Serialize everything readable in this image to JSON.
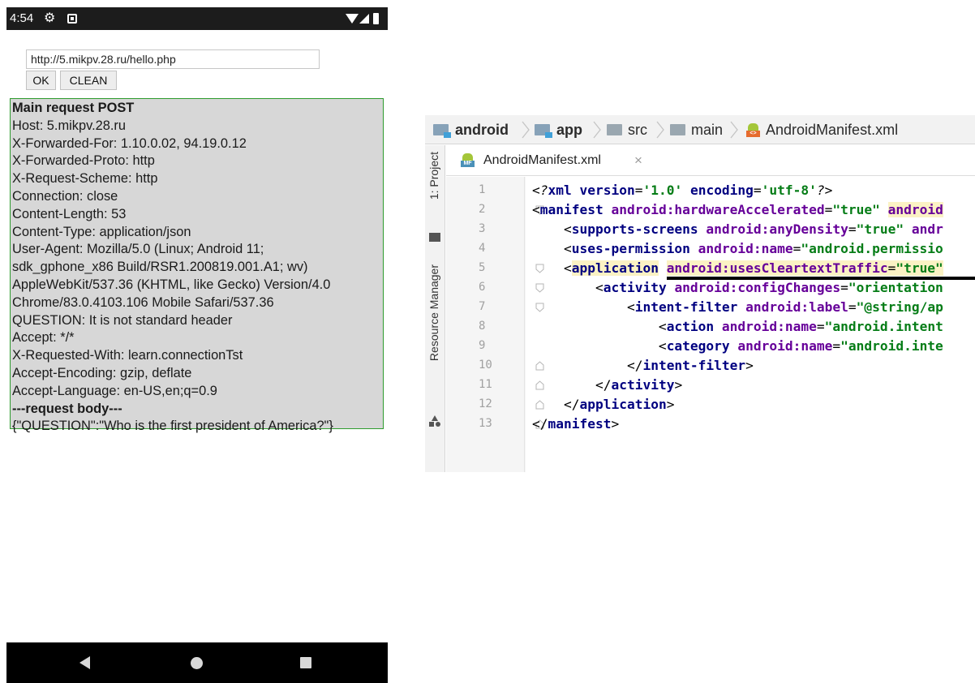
{
  "phone": {
    "status": {
      "time": "4:54",
      "icons": [
        "gear-icon",
        "sim-icon",
        "wifi-icon",
        "signal-icon",
        "battery-icon"
      ]
    },
    "url_value": "http://5.mikpv.28.ru/hello.php",
    "buttons": {
      "ok": "OK",
      "clean": "CLEAN"
    },
    "response_lines": [
      {
        "text": "Main request POST",
        "bold": true
      },
      {
        "text": "Host: 5.mikpv.28.ru",
        "bold": false
      },
      {
        "text": "X-Forwarded-For: 1.10.0.02, 94.19.0.12",
        "bold": false
      },
      {
        "text": "X-Forwarded-Proto: http",
        "bold": false
      },
      {
        "text": "X-Request-Scheme: http",
        "bold": false
      },
      {
        "text": "Connection: close",
        "bold": false
      },
      {
        "text": "Content-Length: 53",
        "bold": false
      },
      {
        "text": "Content-Type: application/json",
        "bold": false
      },
      {
        "text": "User-Agent: Mozilla/5.0 (Linux; Android 11;",
        "bold": false
      },
      {
        "text": "sdk_gphone_x86 Build/RSR1.200819.001.A1; wv)",
        "bold": false
      },
      {
        "text": "AppleWebKit/537.36 (KHTML, like Gecko) Version/4.0",
        "bold": false
      },
      {
        "text": "Chrome/83.0.4103.106 Mobile Safari/537.36",
        "bold": false
      },
      {
        "text": "QUESTION: It is not standard header",
        "bold": false
      },
      {
        "text": "Accept: */*",
        "bold": false
      },
      {
        "text": "X-Requested-With: learn.connectionTst",
        "bold": false
      },
      {
        "text": "Accept-Encoding: gzip, deflate",
        "bold": false
      },
      {
        "text": "Accept-Language: en-US,en;q=0.9",
        "bold": false
      },
      {
        "text": "---request body---",
        "bold": true
      },
      {
        "text": "{\"QUESTION\":\"Who is the first president of America?\"}",
        "bold": false
      }
    ],
    "nav": [
      "back-icon",
      "home-icon",
      "recents-icon"
    ]
  },
  "ide": {
    "breadcrumb": [
      {
        "label": "android",
        "bold": true
      },
      {
        "label": "app",
        "bold": true
      },
      {
        "label": "src",
        "bold": false
      },
      {
        "label": "main",
        "bold": false
      },
      {
        "label": "AndroidManifest.xml",
        "bold": false
      }
    ],
    "left_tabs": {
      "project": "1: Project",
      "resource": "Resource Manager"
    },
    "editor_tab": {
      "label": "AndroidManifest.xml",
      "close": "×",
      "icon_text": "MF"
    },
    "manifest_icon_text": "<>",
    "lines": [
      {
        "num": "1",
        "tokens": [
          {
            "t": "<?",
            "c": "t-pi"
          },
          {
            "t": "xml ",
            "c": "t-tag"
          },
          {
            "t": "version",
            "c": "t-tag"
          },
          {
            "t": "=",
            "c": "t-txt"
          },
          {
            "t": "'1.0' ",
            "c": "t-val"
          },
          {
            "t": "encoding",
            "c": "t-tag"
          },
          {
            "t": "=",
            "c": "t-txt"
          },
          {
            "t": "'utf-8'",
            "c": "t-val"
          },
          {
            "t": "?>",
            "c": "t-pi"
          }
        ]
      },
      {
        "num": "2",
        "tokens": [
          {
            "t": "<",
            "c": "t-txt"
          },
          {
            "t": "manifest ",
            "c": "t-tag"
          },
          {
            "t": "android:hardwareAccelerated",
            "c": "t-attr"
          },
          {
            "t": "=",
            "c": "t-txt"
          },
          {
            "t": "\"true\" ",
            "c": "t-val"
          },
          {
            "t": "android",
            "c": "t-attr hl"
          }
        ]
      },
      {
        "num": "3",
        "tokens": [
          {
            "t": "    <",
            "c": "t-txt"
          },
          {
            "t": "supports-screens ",
            "c": "t-tag"
          },
          {
            "t": "android:anyDensity",
            "c": "t-attr"
          },
          {
            "t": "=",
            "c": "t-txt"
          },
          {
            "t": "\"true\" ",
            "c": "t-val"
          },
          {
            "t": "andr",
            "c": "t-attr"
          }
        ]
      },
      {
        "num": "4",
        "tokens": [
          {
            "t": "    <",
            "c": "t-txt"
          },
          {
            "t": "uses-permission ",
            "c": "t-tag"
          },
          {
            "t": "android:name",
            "c": "t-attr"
          },
          {
            "t": "=",
            "c": "t-txt"
          },
          {
            "t": "\"android.permissio",
            "c": "t-val"
          }
        ]
      },
      {
        "num": "5",
        "tokens": [
          {
            "t": "    <",
            "c": "t-txt"
          },
          {
            "t": "application",
            "c": "t-tag hl"
          },
          {
            "t": " ",
            "c": "t-txt"
          },
          {
            "t": "android:usesCleartextTraffic",
            "c": "t-attr hl"
          },
          {
            "t": "=",
            "c": "t-txt hl"
          },
          {
            "t": "\"true\"",
            "c": "t-val hl"
          }
        ]
      },
      {
        "num": "6",
        "tokens": [
          {
            "t": "        <",
            "c": "t-txt"
          },
          {
            "t": "activity ",
            "c": "t-tag"
          },
          {
            "t": "android:configChanges",
            "c": "t-attr"
          },
          {
            "t": "=",
            "c": "t-txt"
          },
          {
            "t": "\"orientation",
            "c": "t-val"
          }
        ]
      },
      {
        "num": "7",
        "tokens": [
          {
            "t": "            <",
            "c": "t-txt"
          },
          {
            "t": "intent-filter ",
            "c": "t-tag"
          },
          {
            "t": "android:label",
            "c": "t-attr"
          },
          {
            "t": "=",
            "c": "t-txt"
          },
          {
            "t": "\"@string/ap",
            "c": "t-val"
          }
        ]
      },
      {
        "num": "8",
        "tokens": [
          {
            "t": "                <",
            "c": "t-txt"
          },
          {
            "t": "action ",
            "c": "t-tag"
          },
          {
            "t": "android:name",
            "c": "t-attr"
          },
          {
            "t": "=",
            "c": "t-txt"
          },
          {
            "t": "\"android.intent",
            "c": "t-val"
          }
        ]
      },
      {
        "num": "9",
        "tokens": [
          {
            "t": "                <",
            "c": "t-txt"
          },
          {
            "t": "category ",
            "c": "t-tag"
          },
          {
            "t": "android:name",
            "c": "t-attr"
          },
          {
            "t": "=",
            "c": "t-txt"
          },
          {
            "t": "\"android.inte",
            "c": "t-val"
          }
        ]
      },
      {
        "num": "10",
        "tokens": [
          {
            "t": "            </",
            "c": "t-txt"
          },
          {
            "t": "intent-filter",
            "c": "t-tag"
          },
          {
            "t": ">",
            "c": "t-txt"
          }
        ]
      },
      {
        "num": "11",
        "tokens": [
          {
            "t": "        </",
            "c": "t-txt"
          },
          {
            "t": "activity",
            "c": "t-tag"
          },
          {
            "t": ">",
            "c": "t-txt"
          }
        ]
      },
      {
        "num": "12",
        "tokens": [
          {
            "t": "    </",
            "c": "t-txt"
          },
          {
            "t": "application",
            "c": "t-tag"
          },
          {
            "t": ">",
            "c": "t-txt"
          }
        ]
      },
      {
        "num": "13",
        "tokens": [
          {
            "t": "</",
            "c": "t-txt"
          },
          {
            "t": "manifest",
            "c": "t-tag"
          },
          {
            "t": ">",
            "c": "t-txt"
          }
        ]
      }
    ],
    "folds": [
      {
        "line": 2,
        "kind": "open"
      },
      {
        "line": 5,
        "kind": "open"
      },
      {
        "line": 6,
        "kind": "open"
      },
      {
        "line": 7,
        "kind": "open"
      },
      {
        "line": 10,
        "kind": "close"
      },
      {
        "line": 11,
        "kind": "close"
      },
      {
        "line": 12,
        "kind": "close"
      },
      {
        "line": 13,
        "kind": "close"
      }
    ],
    "colors": {
      "tag": "#000080",
      "attr": "#660099",
      "value": "#067d17",
      "highlight": "#fbf2c4"
    }
  }
}
